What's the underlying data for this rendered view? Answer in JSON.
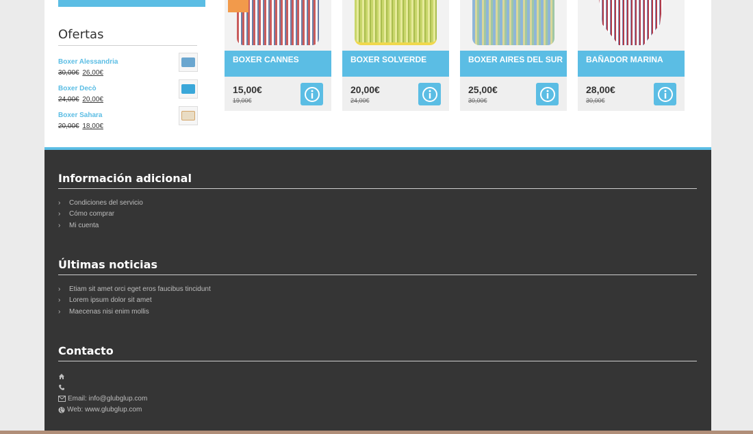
{
  "sidebar": {
    "offers_title": "Ofertas",
    "offers": [
      {
        "name": "Boxer Alessandria",
        "old_price": "30,00€",
        "new_price": "26,00€",
        "thumb_color": "#6aa6cf"
      },
      {
        "name": "Boxer Decò",
        "old_price": "24,00€",
        "new_price": "20,00€",
        "thumb_color": "#3aa7d9"
      },
      {
        "name": "Boxer Sahara",
        "old_price": "20,00€",
        "new_price": "18,00€",
        "thumb_color": "#e9dcc4"
      }
    ]
  },
  "products": [
    {
      "name": "BOXER CANNES",
      "price": "15,00€",
      "old_price": "19,00€",
      "colors": [
        "#c95c5c",
        "#ffffff",
        "#6b7fa6"
      ]
    },
    {
      "name": "BOXER SOLVERDE",
      "price": "20,00€",
      "old_price": "24,00€",
      "colors": [
        "#c8d66a",
        "#e6ea9a",
        "#a9bd4e"
      ]
    },
    {
      "name": "BOXER AIRES DEL SUR",
      "price": "25,00€",
      "old_price": "30,00€",
      "colors": [
        "#8fb6d8",
        "#d9d79a",
        "#9fc7a5"
      ]
    },
    {
      "name": "BAÑADOR MARINA",
      "price": "28,00€",
      "old_price": "30,00€",
      "colors": [
        "#b23b4a",
        "#ffffff",
        "#7a8bb1"
      ]
    }
  ],
  "footer": {
    "info_title": "Información adicional",
    "info_links": [
      "Condiciones del servicio",
      "Cómo comprar",
      "Mi cuenta"
    ],
    "news_title": "Últimas noticias",
    "news_links": [
      "Etiam sit amet orci eget eros faucibus tincidunt",
      "Lorem ipsum dolor sit amet",
      "Maecenas nisi enim mollis"
    ],
    "contact_title": "Contacto",
    "contact": {
      "address": "",
      "phone": "",
      "email": "Email: info@glubglup.com",
      "web": "Web: www.glubglup.com"
    }
  },
  "colors": {
    "accent": "#5bbde4",
    "footer_bg": "#353535"
  },
  "icons": {
    "info": "info-circle-icon",
    "chevron": "chevron-right-icon",
    "home": "home-icon",
    "phone": "phone-icon",
    "email": "envelope-icon",
    "web": "globe-icon"
  }
}
